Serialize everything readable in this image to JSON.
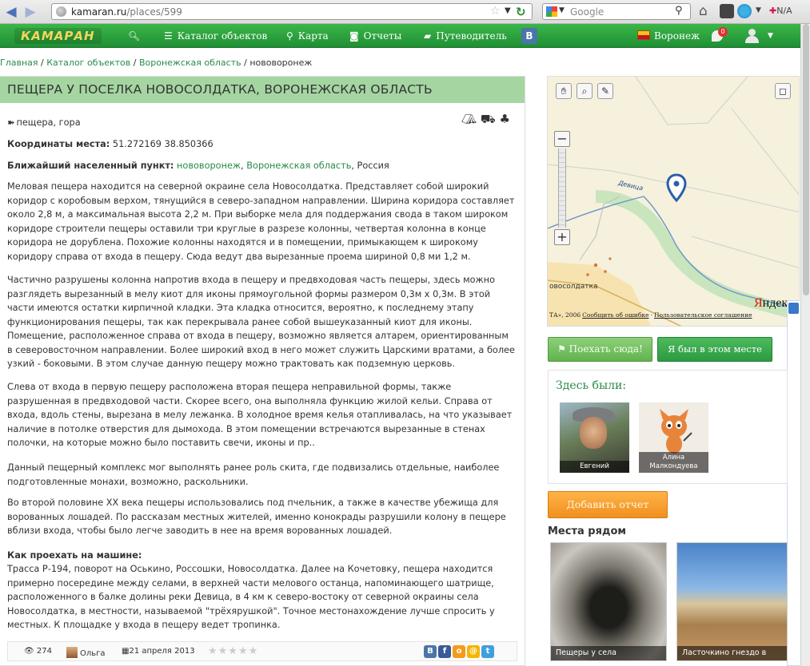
{
  "browser": {
    "url_host": "kamaran.ru",
    "url_path": "/places/599",
    "search_placeholder": "Google",
    "addon_label": "N/A"
  },
  "nav": {
    "logo": "КАМАРАН",
    "catalog": "Каталог объектов",
    "map": "Карта",
    "reports": "Отчеты",
    "guide": "Путеводитель",
    "vk": "В",
    "city": "Воронеж",
    "notifications": "0"
  },
  "breadcrumb": {
    "home": "Главная",
    "catalog": "Каталог объектов",
    "region": "Воронежская область",
    "current": "нововоронеж"
  },
  "place": {
    "title": "ПЕЩЕРА У ПОСЕЛКА НОВОСОЛДАТКА, ВОРОНЕЖСКАЯ ОБЛАСТЬ",
    "tags": "пещера, гора",
    "coords_label": "Координаты места:",
    "coords_value": "51.272169 38.850366",
    "nearest_label": "Ближайший населенный пункт:",
    "nearest_town": "нововоронеж",
    "nearest_region": "Воронежская область",
    "nearest_country": ", Россия",
    "paragraphs": [
      "Меловая пещера находится на северной окраине села Новосолдатка. Представляет собой широкий коридор с коробовым верхом, тянущийся в северо-западном направлении. Ширина коридора составляет около 2,8 м, а максимальная высота 2,2 м. При выборке мела для поддержания свода в таком широком коридоре строители пещеры оставили три круглые в разрезе колонны, четвертая колонна в конце коридора не дорублена. Похожие колонны находятся и в помещении, примыкающем к широкому коридору справа от входа в пещеру. Сюда ведут два вырезанные проема шириной 0,8 ми 1,2 м.",
      "Частично разрушены колонна напротив входа в пещеру и предвходовая часть пещеры, здесь можно разглядеть вырезанный в мелу киот для иконы прямоугольной формы размером 0,3м х 0,3м. В этой части имеются остатки кирпичной кладки. Эта кладка относится, вероятно, к последнему этапу функционирования пещеры, так как перекрывала ранее собой вышеуказанный киот для иконы. Помещение, расположенное справа от входа в пещеру, возможно является алтарем, ориентированным в северовосточном направлении. Более широкий вход в него может служить Царскими вратами, а более узкий - боковыми. В этом случае данную пещеру можно трактовать как подземную церковь.",
      "Слева от входа в первую пещеру расположена вторая пещера неправильной формы, также разрушенная в предвходовой части. Скорее всего, она выполняла функцию жилой кельи. Справа от входа, вдоль стены, вырезана в мелу лежанка. В холодное время келья отапливалась, на что указывает наличие в потолке отверстия для дымохода. В этом помещении встречаются вырезанные в стенах полочки, на которые можно было поставить свечи, иконы и пр..",
      "Данный пещерный комплекс мог выполнять ранее роль скита, где подвизались отдельные, наиболее подготовленные монахи, возможно, раскольники.",
      "Во второй половине XX века пещеры использовались под пчельник, а также в качестве убежища для ворованных лошадей. По рассказам местных жителей, именно конокрады разрушили колону в пещере вблизи входа, чтобы было легче заводить в нее на время ворованных лошадей."
    ],
    "drive_heading": "Как проехать на машине:",
    "drive_text": "Трасса Р-194, поворот на Оськино, Россошки, Новосолдатка. Далее на Кочетовку, пещера находится примерно посередине между селами, в верхней части мелового останца, напоминающего шатрище, расположенного в балке долины реки Девица, в 4 км к северо-востоку от северной окраины села Новосолдатка, в местности, называемой \"трёхярушкой\". Точное местонахождение лучше спросить у местных. К площадке у входа в пещеру ведет тропинка.",
    "views": "274",
    "author": "Ольга",
    "date": "21 апреля 2013"
  },
  "map": {
    "river_label": "Девица",
    "town_label": "овосолдатка",
    "attrib_prefix": "ТА», 2006",
    "attrib_error": "Сообщить об ошибке",
    "attrib_terms": "Пользовательское соглашение",
    "brand": "Яндекс"
  },
  "actions": {
    "go_there": "Поехать сюда!",
    "been_here": "Я был в этом месте",
    "add_report": "Добавить отчет"
  },
  "visitors": {
    "title": "Здесь были:",
    "list": [
      "Евгений",
      "Алина Малкондуева"
    ]
  },
  "nearby": {
    "title": "Места рядом",
    "items": [
      "Пещеры у села",
      "Ласточкино гнездо в"
    ]
  },
  "colors": {
    "nav_green": "#2ea043",
    "title_bg": "#a5d6a2",
    "link_green": "#2a8a4a",
    "orange": "#f0901f"
  }
}
